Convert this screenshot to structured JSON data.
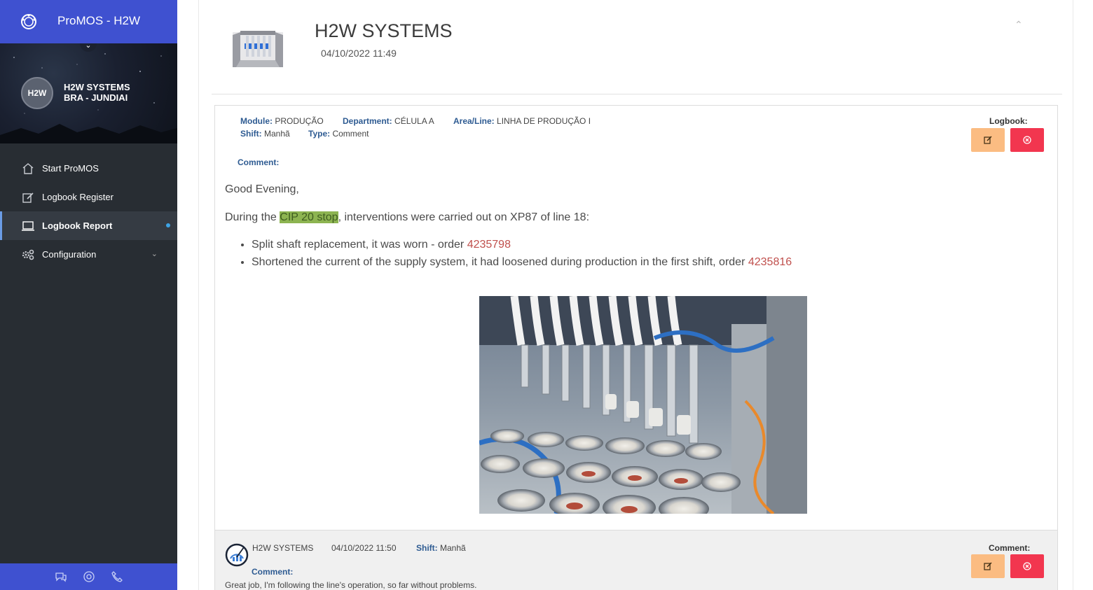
{
  "app": {
    "title": "ProMOS - H2W"
  },
  "profile": {
    "avatar_text": "H2W",
    "company_line1": "H2W SYSTEMS",
    "company_line2": "BRA - JUNDIAI"
  },
  "nav": [
    {
      "label": "Start ProMOS",
      "icon": "home-icon"
    },
    {
      "label": "Logbook Register",
      "icon": "edit-icon"
    },
    {
      "label": "Logbook Report",
      "icon": "laptop-icon",
      "active": true
    },
    {
      "label": "Configuration",
      "icon": "cogs-icon",
      "has_submenu": true
    }
  ],
  "footer_icons": [
    "chat-icon",
    "support-icon",
    "phone-icon"
  ],
  "header": {
    "title": "H2W SYSTEMS",
    "date": "04/10/2022 11:49"
  },
  "entry": {
    "module_label": "Module:",
    "module": "PRODUÇÃO",
    "department_label": "Department:",
    "department": "CÉLULA A",
    "area_label": "Area/Line:",
    "area": "LINHA DE PRODUÇÃO I",
    "shift_label": "Shift:",
    "shift": "Manhã",
    "type_label": "Type:",
    "type": "Comment",
    "logbook_label": "Logbook:",
    "comment_label": "Comment:",
    "greeting": "Good Evening,",
    "intro_before": "During the ",
    "intro_highlight": "CIP 20 stop",
    "intro_after": ", interventions were carried out on XP87 of line 18:",
    "bullets": [
      {
        "text": "Split shaft replacement, it was worn - order ",
        "order": "4235798"
      },
      {
        "text": "Shortened the current of the supply system, it had loosened during production in the first shift, order ",
        "order": "4235816"
      }
    ]
  },
  "reply": {
    "author": "H2W SYSTEMS",
    "date": "04/10/2022 11:50",
    "shift_label": "Shift:",
    "shift": "Manhã",
    "right_label": "Comment:",
    "comment_label": "Comment:",
    "comment": "Great job, I'm following the line's operation, so far without problems."
  },
  "colors": {
    "brand": "#3f51d0",
    "sidebar": "#282d33",
    "edit_button": "#fbbc82",
    "delete_button": "#f2364f",
    "highlight": "#8db451",
    "order_link": "#c0504d"
  }
}
